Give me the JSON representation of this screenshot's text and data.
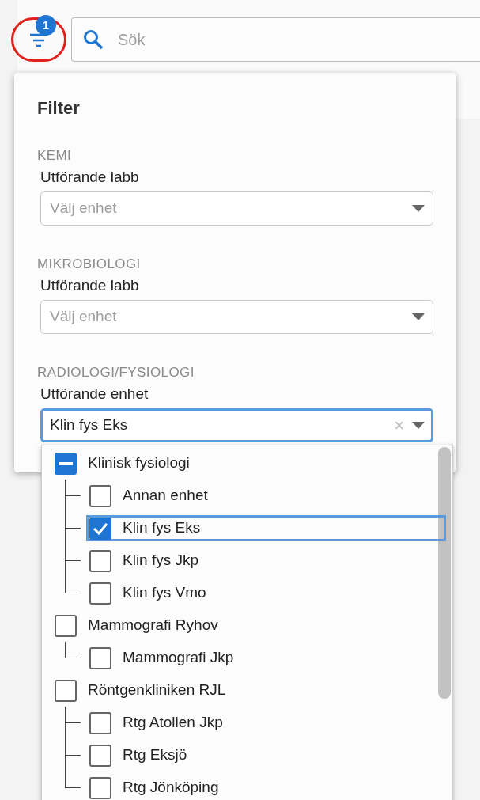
{
  "toolbar": {
    "filter_badge": "1",
    "search": {
      "placeholder": "Sök"
    }
  },
  "filter_panel": {
    "title": "Filter",
    "sections": [
      {
        "heading": "KEMI",
        "label": "Utförande labb",
        "placeholder": "Välj enhet",
        "focused": false
      },
      {
        "heading": "MIKROBIOLOGI",
        "label": "Utförande labb",
        "placeholder": "Välj enhet",
        "focused": false
      },
      {
        "heading": "RADIOLOGI/FYSIOLOGI",
        "label": "Utförande enhet",
        "value": "Klin fys Eks",
        "focused": true,
        "clear": "×"
      }
    ]
  },
  "dropdown": {
    "items": [
      {
        "label": "Klinisk fysiologi",
        "checked": false,
        "indeterminate": true,
        "focused": false,
        "children": [
          {
            "label": "Annan enhet",
            "checked": false,
            "focused": false
          },
          {
            "label": "Klin fys Eks",
            "checked": true,
            "focused": true
          },
          {
            "label": "Klin fys Jkp",
            "checked": false,
            "focused": false
          },
          {
            "label": "Klin fys Vmo",
            "checked": false,
            "focused": false
          }
        ]
      },
      {
        "label": "Mammografi Ryhov",
        "checked": false,
        "indeterminate": false,
        "focused": false,
        "children": [
          {
            "label": "Mammografi Jkp",
            "checked": false,
            "focused": false
          }
        ]
      },
      {
        "label": "Röntgenkliniken RJL",
        "checked": false,
        "indeterminate": false,
        "focused": false,
        "children": [
          {
            "label": "Rtg Atollen Jkp",
            "checked": false,
            "focused": false
          },
          {
            "label": "Rtg Eksjö",
            "checked": false,
            "focused": false
          },
          {
            "label": "Rtg Jönköping",
            "checked": false,
            "focused": false
          }
        ]
      }
    ]
  }
}
